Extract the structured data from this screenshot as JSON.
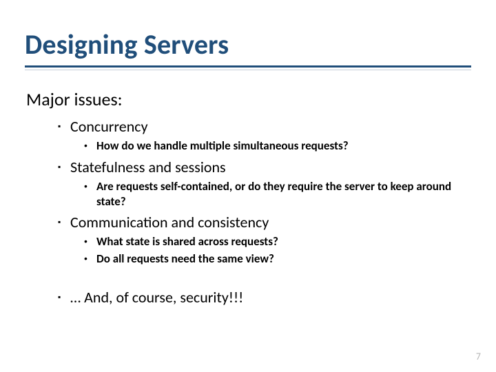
{
  "title": "Designing Servers",
  "subtitle": "Major issues:",
  "items": [
    {
      "label": "Concurrency",
      "sub": [
        "How do we handle multiple simultaneous requests?"
      ]
    },
    {
      "label": "Statefulness and sessions",
      "sub": [
        "Are requests self-contained, or do they require the server to keep around state?"
      ]
    },
    {
      "label": "Communication and consistency",
      "sub": [
        "What state is shared across requests?",
        "Do all requests need the same view?"
      ]
    },
    {
      "label": "… And, of course, security!!!",
      "sub": []
    }
  ],
  "page_number": "7"
}
